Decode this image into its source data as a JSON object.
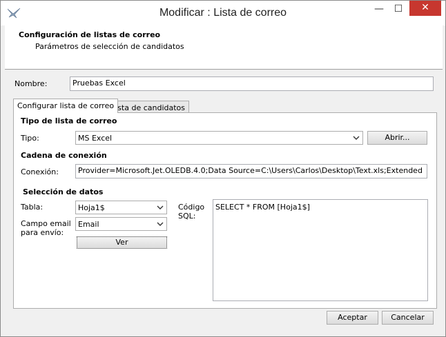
{
  "window": {
    "title": "Modificar : Lista de correo",
    "minimize_glyph": "—",
    "maximize_glyph": "☐",
    "close_glyph": "✕"
  },
  "header": {
    "title": "Configuración de listas de correo",
    "subtitle": "Parámetros de selección de candidatos"
  },
  "form": {
    "nombre_label": "Nombre:",
    "nombre_value": "Pruebas Excel"
  },
  "tabs": [
    {
      "label": "Configurar lista de correo",
      "active": true
    },
    {
      "label": "Lista de candidatos",
      "active": false
    }
  ],
  "tipo_section": {
    "heading": "Tipo de lista de correo",
    "tipo_label": "Tipo:",
    "tipo_value": "MS Excel",
    "abrir_label": "Abrir..."
  },
  "conexion_section": {
    "heading": "Cadena de conexión",
    "conexion_label": "Conexión:",
    "conexion_value": "Provider=Microsoft.Jet.OLEDB.4.0;Data Source=C:\\Users\\Carlos\\Desktop\\Text.xls;Extended"
  },
  "datos_section": {
    "heading": "Selección de datos",
    "tabla_label": "Tabla:",
    "tabla_value": "Hoja1$",
    "campo_email_label_line1": "Campo email",
    "campo_email_label_line2": "para envío:",
    "campo_email_value": "Email",
    "ver_label": "Ver",
    "codigo_label_line1": "Código",
    "codigo_label_line2": "SQL:",
    "sql_value": "SELECT * FROM [Hoja1$]"
  },
  "footer": {
    "aceptar_label": "Aceptar",
    "cancelar_label": "Cancelar"
  },
  "colors": {
    "close_button": "#c7372f",
    "window_bg": "#f0f0f0",
    "panel_bg": "#ffffff"
  }
}
